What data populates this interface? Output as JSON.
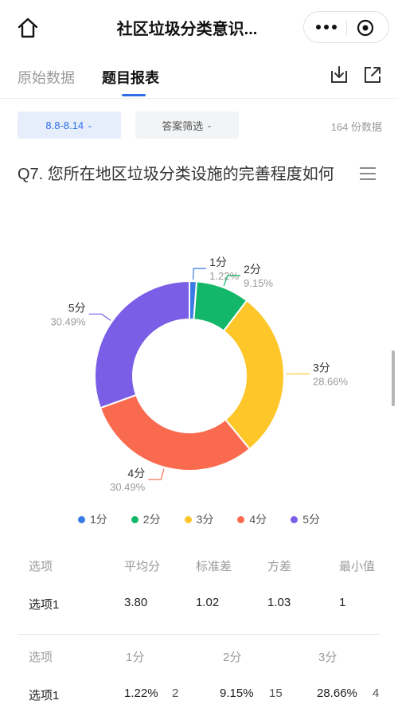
{
  "titlebar": {
    "title": "社区垃圾分类意识..."
  },
  "tabs": [
    {
      "label": "原始数据",
      "active": false
    },
    {
      "label": "题目报表",
      "active": true
    }
  ],
  "filters": {
    "date_range": "8.8-8.14",
    "answer_filter": "答案筛选",
    "count_text": "164 份数据"
  },
  "question": {
    "text": "Q7. 您所在地区垃圾分类设施的完善程度如何"
  },
  "chart_data": {
    "type": "pie",
    "donut": true,
    "categories": [
      "1分",
      "2分",
      "3分",
      "4分",
      "5分"
    ],
    "values": [
      1.22,
      9.15,
      28.66,
      30.49,
      30.49
    ],
    "value_labels": [
      "1.22%",
      "9.15%",
      "28.66%",
      "30.49%",
      "30.49%"
    ],
    "colors": [
      "#3b7be6",
      "#12b76a",
      "#fdc72a",
      "#fa6a4f",
      "#7b5ee6"
    ],
    "legend_position": "bottom"
  },
  "stats_table": {
    "headers": [
      "选项",
      "平均分",
      "标准差",
      "方差",
      "最小值"
    ],
    "rows": [
      [
        "选项1",
        "3.80",
        "1.02",
        "1.03",
        "1"
      ]
    ]
  },
  "distribution_table": {
    "headers": [
      "选项",
      "1分",
      "2分",
      "3分"
    ],
    "rows": [
      {
        "option": "选项1",
        "cells": [
          {
            "pct": "1.22%",
            "count": "2"
          },
          {
            "pct": "9.15%",
            "count": "15"
          },
          {
            "pct": "28.66%",
            "count": "4"
          }
        ]
      }
    ]
  },
  "icons": {
    "home": "home-icon",
    "more": "more-dots-icon",
    "close": "target-close-icon",
    "download": "download-icon",
    "share": "share-external-icon",
    "menu": "hamburger-menu-icon"
  },
  "colors": {
    "accent": "#2e6fe8",
    "muted_text": "#9a9a9a"
  }
}
